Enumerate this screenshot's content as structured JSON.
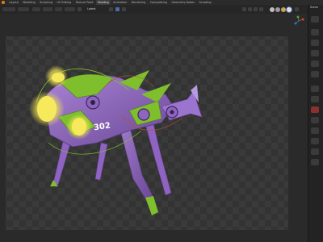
{
  "app": {
    "workspaces": [
      "Layout",
      "Modeling",
      "Sculpting",
      "UV Editing",
      "Texture Paint",
      "Shading",
      "Animation",
      "Rendering",
      "Compositing",
      "Geometry Nodes",
      "Scripting"
    ],
    "active_workspace": "Shading",
    "header_title": "Latest",
    "render_engine_title": "Scene"
  },
  "scene": {
    "subject": "purple-green mech fish robot with glowing yellow lights",
    "label_on_body": "302"
  },
  "colors": {
    "body_purple": "#8f63c2",
    "body_green": "#7fbf2d",
    "glow_yellow": "#f2e54f",
    "viewport_bg": "#2a2a2a",
    "ui_dark": "#1d1d1d",
    "accent_blue": "#4a6ea3"
  },
  "icons": {
    "logo": "blender-logo-icon",
    "gizmo": "navigation-gizmo-icon",
    "props": [
      "tool-icon",
      "render-icon",
      "output-icon",
      "view-layer-icon",
      "scene-icon",
      "world-icon",
      "object-icon",
      "modifier-icon",
      "particles-icon",
      "physics-icon",
      "constraints-icon",
      "data-icon",
      "material-icon",
      "texture-icon"
    ]
  }
}
